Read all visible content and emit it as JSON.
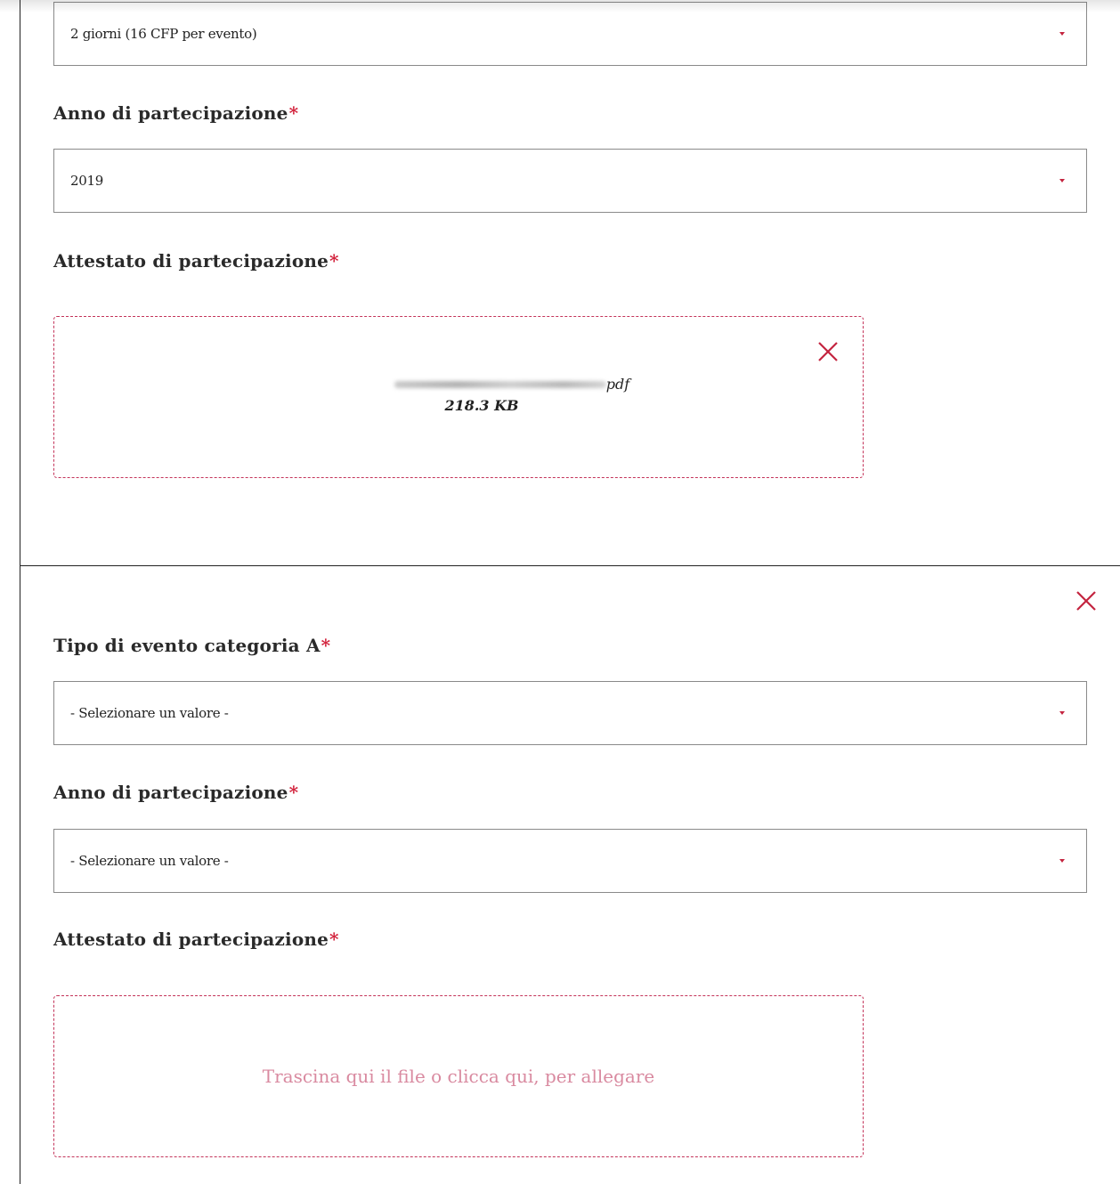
{
  "section1": {
    "event_days_select": {
      "value": "2 giorni (16 CFP per evento)"
    },
    "year_label": "Anno di partecipazione",
    "year_select": {
      "value": "2019"
    },
    "certificate_label": "Attestato di partecipazione",
    "uploaded_file": {
      "name_visible_part": "pdf",
      "size": "218.3 KB"
    }
  },
  "section2": {
    "event_type_label": "Tipo di evento categoria A",
    "event_type_select": {
      "value": "- Selezionare un valore -"
    },
    "year_label": "Anno di partecipazione",
    "year_select": {
      "value": "- Selezionare un valore -"
    },
    "certificate_label": "Attestato di partecipazione",
    "dropzone_hint": "Trascina qui il file o clicca qui, per allegare"
  },
  "required_marker": "*",
  "colors": {
    "accent": "#c4243f",
    "required": "#d2203a",
    "dropzone_border": "#c4345a",
    "hint_text": "#d98aa0"
  },
  "icons": {
    "close": "close-icon",
    "caret": "caret-down-icon"
  }
}
